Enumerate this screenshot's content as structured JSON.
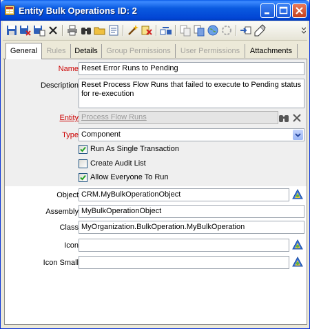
{
  "window": {
    "title": "Entity Bulk Operations ID: 2",
    "controls": [
      "minimize",
      "maximize",
      "close"
    ]
  },
  "toolbar": {
    "icons": [
      "save-icon",
      "save-close-icon",
      "save-new-icon",
      "delete-icon",
      "print-icon",
      "find-icon",
      "open-folder-icon",
      "properties-icon",
      "wizard-icon",
      "clear-icon",
      "move-icon",
      "copy-icon",
      "copy-to-icon",
      "globe-icon",
      "refresh-icon",
      "go-to-icon",
      "notes-icon"
    ]
  },
  "tabs": [
    {
      "label": "General",
      "state": "active"
    },
    {
      "label": "Rules",
      "state": "disabled"
    },
    {
      "label": "Details",
      "state": "enabled"
    },
    {
      "label": "Group Permissions",
      "state": "disabled"
    },
    {
      "label": "User Permissions",
      "state": "disabled"
    },
    {
      "label": "Attachments",
      "state": "enabled"
    }
  ],
  "form": {
    "name": {
      "label": "Name",
      "value": "Reset Error Runs to Pending"
    },
    "description": {
      "label": "Description",
      "value": "Reset Process Flow Runs that failed to execute to Pending status for re-execution"
    },
    "entity": {
      "label": "Entity",
      "value": "Process Flow Runs"
    },
    "type": {
      "label": "Type",
      "value": "Component"
    },
    "run_single_transaction": {
      "label": "Run As Single Transaction",
      "checked": true
    },
    "create_audit_list": {
      "label": "Create Audit List",
      "checked": false
    },
    "allow_everyone": {
      "label": "Allow Everyone To Run",
      "checked": true
    },
    "object": {
      "label": "Object",
      "value": "CRM.MyBulkOperationObject"
    },
    "assembly": {
      "label": "Assembly",
      "value": "MyBulkOperationObject"
    },
    "class": {
      "label": "Class",
      "value": "MyOrganization.BulkOperation.MyBulkOperation"
    },
    "icon": {
      "label": "Icon",
      "value": ""
    },
    "icon_small": {
      "label": "Icon Small",
      "value": ""
    }
  },
  "colors": {
    "title_bar": "#0a5ae0",
    "required_label": "#cc0000",
    "disabled_tab": "#a6a5a0"
  }
}
